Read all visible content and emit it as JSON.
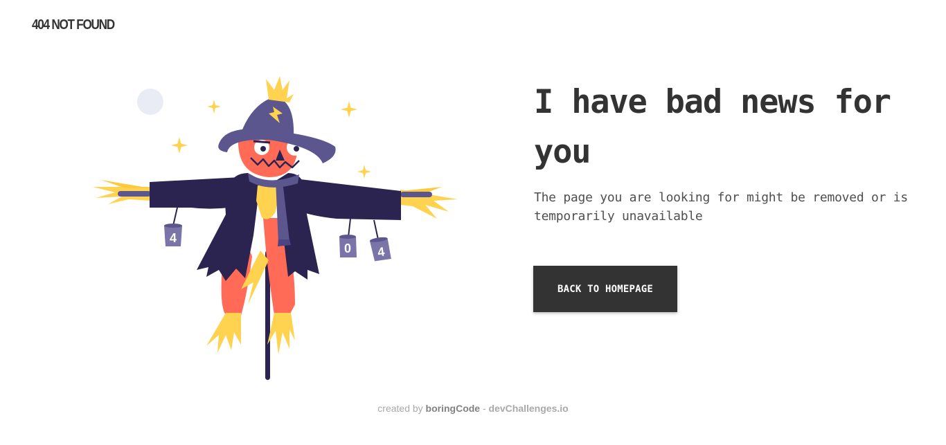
{
  "header": {
    "brand": "404 NOT FOUND"
  },
  "illustration": {
    "name": "scarecrow",
    "can_labels": [
      "4",
      "0",
      "4"
    ],
    "colors": {
      "coat": "#2b2450",
      "hat": "#5c568f",
      "face": "#ff6b57",
      "straw": "#ffd24f",
      "cans": "#7b74a8",
      "moon": "#e9ecf5"
    }
  },
  "main": {
    "headline": "I have bad news for you",
    "message": "The page you are looking for might be removed or is temporarily unavailable",
    "cta_label": "BACK TO HOMEPAGE"
  },
  "footer": {
    "prefix": "created by",
    "author": "boringCode",
    "separator": "-",
    "site": "devChallenges.io"
  },
  "colors": {
    "text": "#333333",
    "button_bg": "#333333",
    "button_text": "#ffffff",
    "footer_text": "#a9a9a9"
  }
}
